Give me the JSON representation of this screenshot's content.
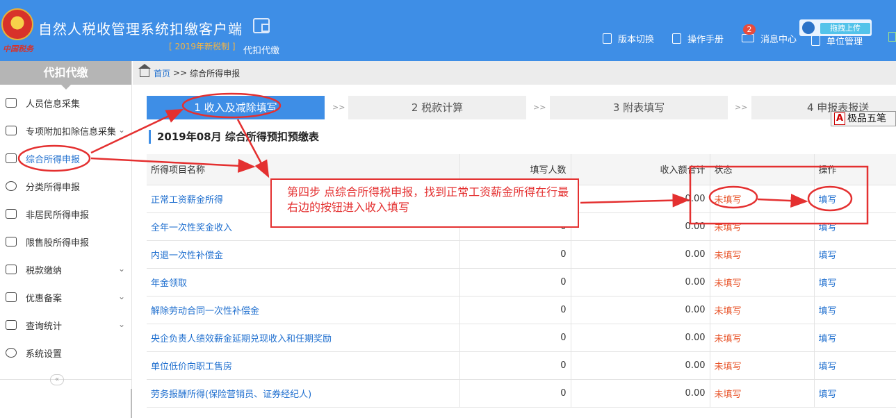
{
  "header": {
    "title": "自然人税收管理系统扣缴客户端",
    "subtitle": "[ 2019年新税制 ]",
    "emblem_script": "中国税务",
    "module_label": "代扣代缴",
    "nav": [
      "版本切换",
      "操作手册",
      "消息中心",
      "单位管理"
    ],
    "message_count": "2",
    "upload_label": "拖拽上传"
  },
  "sidebar": {
    "heading": "代扣代缴",
    "items": [
      {
        "label": "人员信息采集",
        "icon": "person-icon",
        "chevron": false
      },
      {
        "label": "专项附加扣除信息采集",
        "icon": "list-icon",
        "chevron": true
      },
      {
        "label": "综合所得申报",
        "icon": "layers-icon",
        "chevron": false,
        "active": true
      },
      {
        "label": "分类所得申报",
        "icon": "pie-icon",
        "chevron": false
      },
      {
        "label": "非居民所得申报",
        "icon": "user-outline-icon",
        "chevron": false
      },
      {
        "label": "限售股所得申报",
        "icon": "bar-chart-icon",
        "chevron": false
      },
      {
        "label": "税款缴纳",
        "icon": "folder-icon",
        "chevron": true
      },
      {
        "label": "优惠备案",
        "icon": "document-icon",
        "chevron": true
      },
      {
        "label": "查询统计",
        "icon": "search-list-icon",
        "chevron": true
      },
      {
        "label": "系统设置",
        "icon": "gear-icon",
        "chevron": false
      }
    ],
    "collapse_glyph": "«"
  },
  "breadcrumb": {
    "home": "首页",
    "separator": ">>",
    "current": "综合所得申报"
  },
  "steps": [
    {
      "label": "1 收入及减除填写",
      "active": true
    },
    {
      "label": "2 税款计算",
      "active": false
    },
    {
      "label": "3 附表填写",
      "active": false
    },
    {
      "label": "4 申报表报送",
      "active": false
    }
  ],
  "step_separator": ">>",
  "ime": {
    "logo": "A",
    "label": "极品五笔"
  },
  "section_title": "2019年08月  综合所得预扣预缴表",
  "table": {
    "headers": [
      "所得项目名称",
      "填写人数",
      "收入额合计",
      "状态",
      "操作"
    ],
    "rows": [
      [
        "正常工资薪金所得",
        "0",
        "0.00",
        "未填写",
        "填写"
      ],
      [
        "全年一次性奖金收入",
        "0",
        "0.00",
        "未填写",
        "填写"
      ],
      [
        "内退一次性补偿金",
        "0",
        "0.00",
        "未填写",
        "填写"
      ],
      [
        "年金领取",
        "0",
        "0.00",
        "未填写",
        "填写"
      ],
      [
        "解除劳动合同一次性补偿金",
        "0",
        "0.00",
        "未填写",
        "填写"
      ],
      [
        "央企负责人绩效薪金延期兑现收入和任期奖励",
        "0",
        "0.00",
        "未填写",
        "填写"
      ],
      [
        "单位低价向职工售房",
        "0",
        "0.00",
        "未填写",
        "填写"
      ],
      [
        "劳务报酬所得(保险营销员、证券经纪人)",
        "0",
        "0.00",
        "未填写",
        "填写"
      ]
    ]
  },
  "annotation": {
    "text": "第四步  点综合所得税申报，找到正常工资薪金所得在行最右边的按钮进入收入填写",
    "color": "#e43030"
  },
  "colors": {
    "primary": "#3e8ee6",
    "link": "#1f6fcf",
    "status": "#e8542a",
    "annotation": "#e43030"
  }
}
